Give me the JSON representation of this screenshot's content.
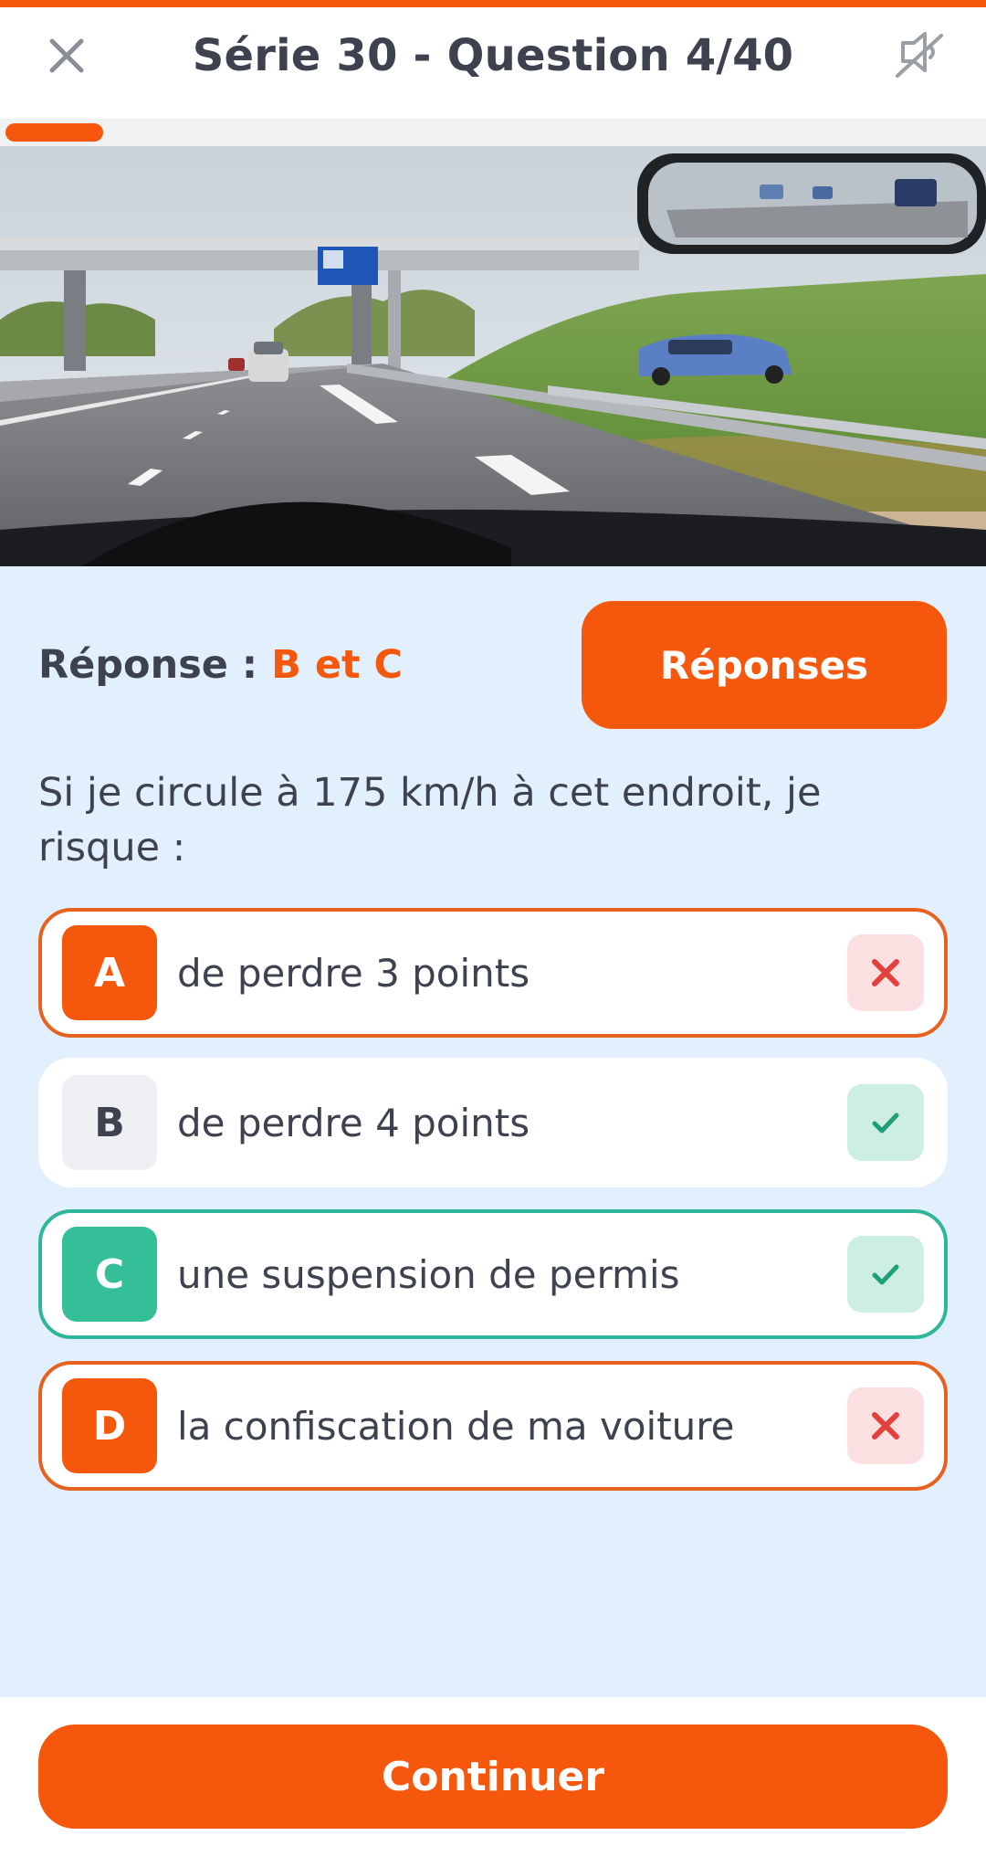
{
  "header": {
    "title": "Série 30 - Question 4/40",
    "close_icon": "close-icon",
    "sound_icon": "sound-off-icon"
  },
  "progress": {
    "current": 4,
    "total": 40
  },
  "answer": {
    "label": "Réponse :",
    "value": "B et C"
  },
  "reponses_button": "Réponses",
  "question": "Si je circule à 175 km/h à cet endroit, je risque :",
  "options": [
    {
      "letter": "A",
      "text": "de perdre 3 points",
      "status": "wrong",
      "mark": "x-icon"
    },
    {
      "letter": "B",
      "text": "de perdre 4 points",
      "status": "correct-missed",
      "mark": "check-icon"
    },
    {
      "letter": "C",
      "text": "une suspension de permis",
      "status": "correct",
      "mark": "check-icon"
    },
    {
      "letter": "D",
      "text": "la confiscation de ma voiture",
      "status": "wrong",
      "mark": "x-icon"
    }
  ],
  "continue_button": "Continuer",
  "colors": {
    "accent": "#f5580d",
    "correct": "#34bf98",
    "wrong_mark": "#e0413c",
    "background": "#e2f0fd"
  }
}
